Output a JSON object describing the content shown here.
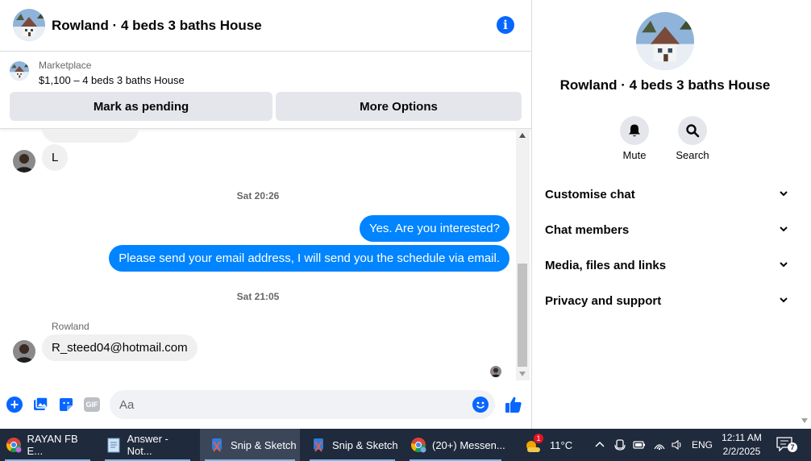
{
  "header": {
    "title": "Rowland · 4 beds 3 baths House"
  },
  "marketplace": {
    "label": "Marketplace",
    "item": "$1,100 – 4 beds 3 baths House",
    "pending_label": "Mark as pending",
    "more_label": "More Options"
  },
  "messages": {
    "first_incoming": "L",
    "ts1": "Sat 20:26",
    "out1": "Yes. Are you interested?",
    "out2": "Please send your email address, I will send you the schedule via email.",
    "ts2": "Sat 21:05",
    "sender": "Rowland",
    "last_incoming": "R_steed04@hotmail.com"
  },
  "composer": {
    "placeholder": "Aa",
    "gif": "GIF"
  },
  "side": {
    "title": "Rowland · 4 beds 3 baths House",
    "mute": "Mute",
    "search": "Search",
    "sections": [
      "Customise chat",
      "Chat members",
      "Media, files and links",
      "Privacy and support"
    ]
  },
  "taskbar": {
    "apps": [
      "RAYAN FB E...",
      "Answer - Not...",
      "Snip & Sketch",
      "Snip & Sketch",
      "(20+) Messen..."
    ],
    "badge": "1",
    "weather": "11°C",
    "lang": "ENG",
    "time": "12:11 AM",
    "date": "2/2/2025",
    "notif_count": "7"
  },
  "colors": {
    "accent": "#0866ff",
    "bubble_out": "#0084ff",
    "bubble_in": "#f0f0f0",
    "taskbar": "#1f2a3c"
  }
}
